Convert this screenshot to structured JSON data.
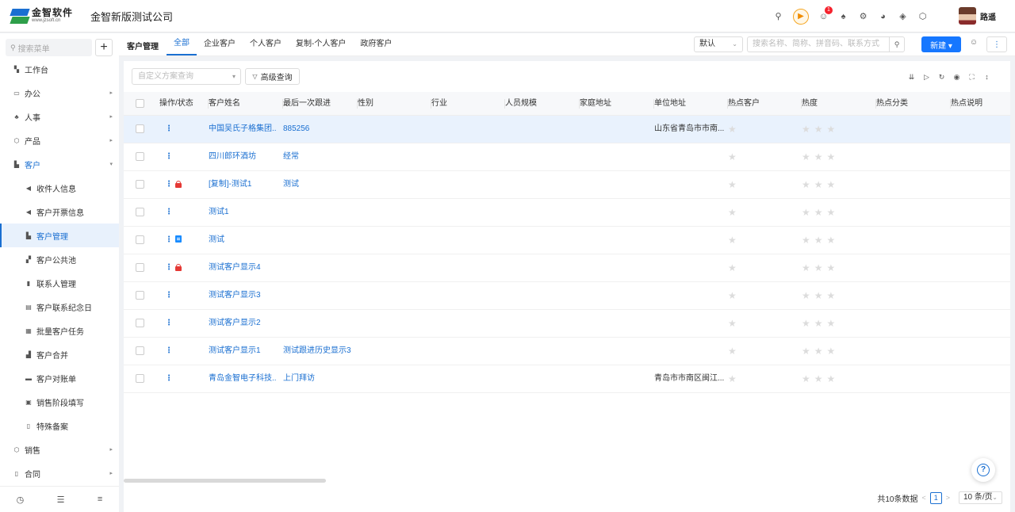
{
  "header": {
    "logo_cn": "金智软件",
    "logo_en": "www.jzsoft.cn",
    "company": "金智新版测试公司",
    "notification_count": "1",
    "user_name": "路遥"
  },
  "sidebar": {
    "search_placeholder": "搜索菜单",
    "items": [
      {
        "label": "工作台",
        "icon": "grid-icon",
        "glyph": "▚",
        "type": "top"
      },
      {
        "label": "办公",
        "icon": "monitor-icon",
        "glyph": "▭",
        "type": "top",
        "arrow": "▸"
      },
      {
        "label": "人事",
        "icon": "people-icon",
        "glyph": "♣",
        "type": "top",
        "arrow": "▸"
      },
      {
        "label": "产品",
        "icon": "box-icon",
        "glyph": "⬡",
        "type": "top",
        "arrow": "▸"
      },
      {
        "label": "客户",
        "icon": "chart-icon",
        "glyph": "▙",
        "type": "open",
        "arrow": "▾"
      },
      {
        "label": "收件人信息",
        "icon": "speaker-icon",
        "glyph": "◀",
        "type": "sub"
      },
      {
        "label": "客户开票信息",
        "icon": "speaker-icon",
        "glyph": "◀",
        "type": "sub"
      },
      {
        "label": "客户管理",
        "icon": "chart-icon",
        "glyph": "▙",
        "type": "active"
      },
      {
        "label": "客户公共池",
        "icon": "people-icon",
        "glyph": "▞",
        "type": "sub"
      },
      {
        "label": "联系人管理",
        "icon": "contact-icon",
        "glyph": "▮",
        "type": "sub"
      },
      {
        "label": "客户联系纪念日",
        "icon": "calendar-icon",
        "glyph": "▤",
        "type": "sub"
      },
      {
        "label": "批量客户任务",
        "icon": "stack-icon",
        "glyph": "▦",
        "type": "sub"
      },
      {
        "label": "客户合并",
        "icon": "merge-icon",
        "glyph": "▟",
        "type": "sub"
      },
      {
        "label": "客户对账单",
        "icon": "bill-icon",
        "glyph": "▬",
        "type": "sub"
      },
      {
        "label": "销售阶段填写",
        "icon": "form-icon",
        "glyph": "▣",
        "type": "sub"
      },
      {
        "label": "特殊备案",
        "icon": "file-icon",
        "glyph": "▯",
        "type": "sub"
      },
      {
        "label": "销售",
        "icon": "shield-icon",
        "glyph": "⬡",
        "type": "top",
        "arrow": "▸"
      },
      {
        "label": "合同",
        "icon": "contract-icon",
        "glyph": "▯",
        "type": "top",
        "arrow": "▸"
      }
    ]
  },
  "main": {
    "page_title": "客户管理",
    "tabs": [
      "全部",
      "企业客户",
      "个人客户",
      "复制-个人客户",
      "政府客户"
    ],
    "sort_select": "默认",
    "search_placeholder": "搜索名称、简称、拼音码、联系方式",
    "new_button": "新建 ▾",
    "scheme_placeholder": "自定义方案查询",
    "advanced_query": "高级查询"
  },
  "table": {
    "columns": [
      "操作/状态",
      "客户姓名",
      "最后一次跟进",
      "性别",
      "行业",
      "人员规模",
      "家庭地址",
      "单位地址",
      "热点客户",
      "热度",
      "热点分类",
      "热点说明"
    ],
    "rows": [
      {
        "name": "中国吴氏子格集团...",
        "followup": "885256",
        "unit_address": "山东省青岛市市南...",
        "status": "",
        "highlight": true
      },
      {
        "name": "四川郎环酒坊",
        "followup": "经常",
        "unit_address": "",
        "status": ""
      },
      {
        "name": "[复制]-测试1",
        "followup": "测试",
        "unit_address": "",
        "status": "locked"
      },
      {
        "name": "测试1",
        "followup": "",
        "unit_address": "",
        "status": ""
      },
      {
        "name": "测试",
        "followup": "",
        "unit_address": "",
        "status": "doc"
      },
      {
        "name": "测试客户显示4",
        "followup": "",
        "unit_address": "",
        "status": "locked"
      },
      {
        "name": "测试客户显示3",
        "followup": "",
        "unit_address": "",
        "status": ""
      },
      {
        "name": "测试客户显示2",
        "followup": "",
        "unit_address": "",
        "status": ""
      },
      {
        "name": "测试客户显示1",
        "followup": "测试跟进历史显示3",
        "unit_address": "",
        "status": ""
      },
      {
        "name": "青岛金智电子科技...",
        "followup": "上门拜访",
        "unit_address": "青岛市市南区闽江...",
        "status": ""
      }
    ]
  },
  "pager": {
    "total": "共10条数据",
    "current": "1",
    "page_size": "10 条/页"
  }
}
